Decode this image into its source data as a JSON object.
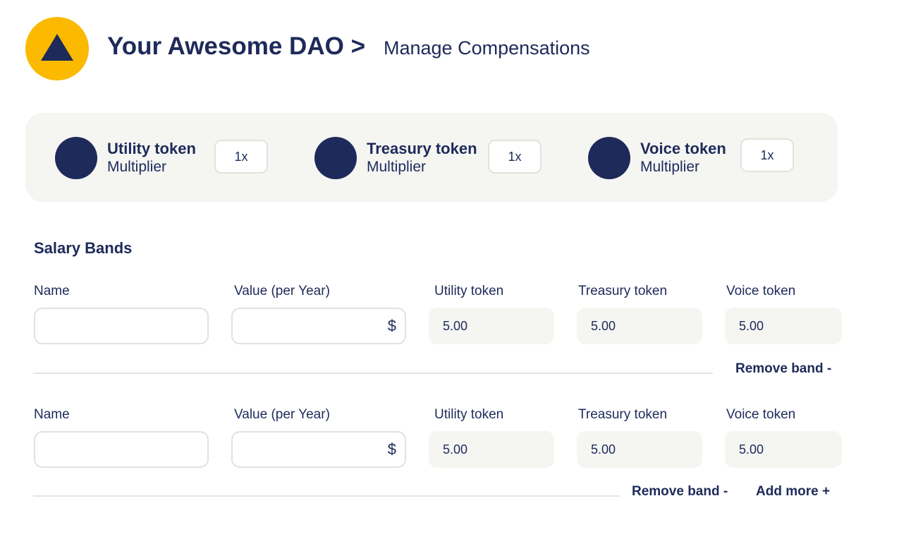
{
  "header": {
    "dao_name": "Your Awesome DAO",
    "separator": ">",
    "page_title": "Manage Compensations"
  },
  "multipliers": [
    {
      "name": "Utility token",
      "sub": "Multiplier",
      "value": "1x"
    },
    {
      "name": "Treasury token",
      "sub": "Multiplier",
      "value": "1x"
    },
    {
      "name": "Voice token",
      "sub": "Multiplier",
      "value": "1x"
    }
  ],
  "salary_bands": {
    "title": "Salary Bands",
    "labels": {
      "name": "Name",
      "value": "Value (per Year)",
      "utility": "Utility token",
      "treasury": "Treasury token",
      "voice": "Voice token"
    },
    "currency_symbol": "$",
    "bands": [
      {
        "name": "",
        "value": "",
        "utility": "5.00",
        "treasury": "5.00",
        "voice": "5.00"
      },
      {
        "name": "",
        "value": "",
        "utility": "5.00",
        "treasury": "5.00",
        "voice": "5.00"
      }
    ],
    "remove_label": "Remove band -",
    "add_label": "Add more +"
  },
  "colors": {
    "brand_navy": "#1e2a5a",
    "logo_yellow": "#fbb900",
    "panel_bg": "#f5f5f2"
  }
}
